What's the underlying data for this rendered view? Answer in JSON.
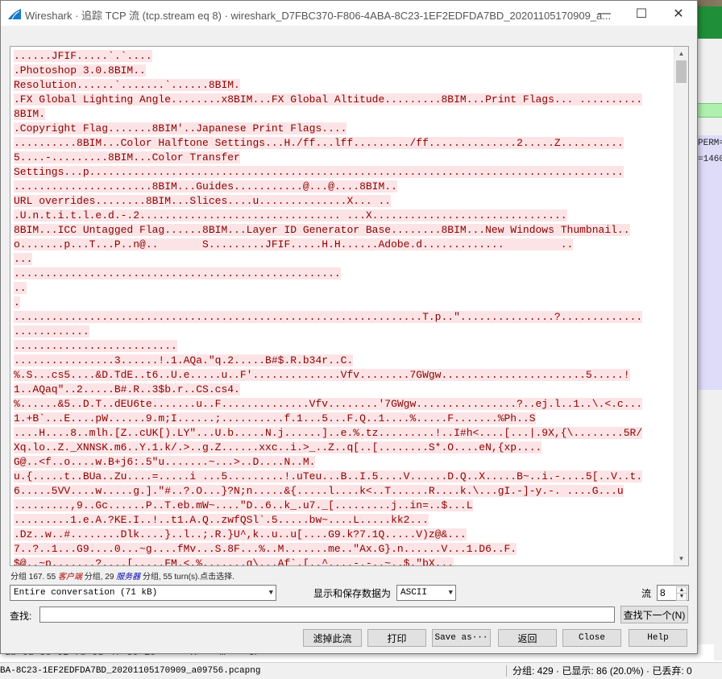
{
  "window": {
    "title": "Wireshark · 追踪 TCP 流 (tcp.stream eq 8) · wireshark_D7FBC370-F806-4ABA-8C23-1EF2EDFDA7BD_20201105170909_a...",
    "minimize_glyph": "—",
    "maximize_glyph": "☐",
    "close_glyph": "✕"
  },
  "stream_lines": [
    "......JFIF.....`.`....",
    ".Photoshop 3.0.8BIM..",
    "Resolution......`.......`......8BIM.",
    ".FX Global Lighting Angle........x8BIM...FX Global Altitude.........8BIM...Print Flags... ..........",
    "8BIM.",
    ".Copyright Flag.......8BIM'..Japanese Print Flags....",
    "..........8BIM...Color Halftone Settings...H./ff...lff........./ff..............2.....Z..........",
    "5....-.........8BIM...Color Transfer",
    "Settings...p.....................................................................................",
    "......................8BIM...Guides...........@...@....8BIM..",
    "URL overrides........8BIM...Slices....u..............X... ..",
    ".U.n.t.i.t.l.e.d.-.2................................ ...X...............................",
    "8BIM...ICC Untagged Flag......8BIM...Layer ID Generator Base........8BIM...New Windows Thumbnail..",
    "o.......p...T...P..n@..       S.........JFIF.....H.H......Adobe.d.............         ..",
    "...",
    "....................................................",
    "..",
    ".",
    ".................................................................T.p..\"...............?.............",
    "............",
    "..........................",
    "................3......!.1.AQa.\"q.2.....B#$.R.b34r..C.",
    "%.S...cs5....&D.TdE..t6..U.e.....u..F'..............Vfv........7GWgw.......................5.....!",
    "1..AQaq\"..2.....B#.R..3$b.r..CS.cs4.",
    "%......&5..D.T..dEU6te.......u..F..............Vfv........'7GWgw................?..ej.l..1..\\.<.c...",
    "1.+B`...E....pW......9.m;I......;..........f.1...5...F.Q..1....%.....F.......%Ph..S",
    "....H....8..mlh.[Z..cUK[).LY\"...U.b.....N.j......]..e.%.tz.........!..I#h<....[...|.9X,{\\........5R/",
    "Xq.lo..Z._XNNSK.m6..Y.1.k/.>..g.Z......xxc..i.>_..Z..q[..[........S*.O....eN,{xp....",
    "G@..<f..o....w.B+j6:.5\"u.......~...>..D....N..M.",
    "u.{.....t..BUa..Zu....=.....i ...5.........!.uTeu...B..I.5....V......D.Q..X.....B~..i.-....5[..V..t.",
    "6.....5VV....w.....g.].\"#..?.O...}?N;n.....&{.....l....k<..T......R....k.\\...gI.-]-y.-. ....G...u",
    ".........,9..Gc......P..T.eb.mW~....\"D..6..k_.u7._[.........j..in=..$...L",
    ".........1.e.A.?KE.I..!..t1.A.Q..zwfQSl`.5.....bw~....L.....kk2...",
    ".Dz..w..#........Dlk....}..l..;.R.}U^,k..u..u[....G9.k?7.1Q.....V)z@&...",
    "7..?..1...G9....0...~g....fMv...S.8F...%..M.......me..\"Ax.G}.n......V...1.D6..F.",
    "$@..~p.......?....[.....FM.<.%.......g\\...Af`.[..^....-.-..~..$.\"bX..."
  ],
  "info": {
    "prefix": "分组 167. 55 ",
    "client_label": "客户端",
    "middle": " 分组, 29 ",
    "server_label": "服务器",
    "suffix": " 分组, 55 turn(s).点击选择."
  },
  "controls": {
    "conversation_select": "Entire conversation (71 kB)",
    "display_label": "显示和保存数据为",
    "format_select": "ASCII",
    "stream_label": "流",
    "stream_value": "8",
    "find_label": "查找:",
    "find_value": "",
    "find_next_button": "查找下一个(N)"
  },
  "buttons": {
    "filter_out": "滤掉此流",
    "print": "打印",
    "save_as": "Save as···",
    "back": "返回",
    "close": "Close",
    "help": "Help"
  },
  "background": {
    "perm_text": "PERM=",
    "perm_num": "=1460",
    "hex_line": "db  0d 5e 02 fb cd 47 30 10   ·+···X··· m ···GP·",
    "status_file": "BA-8C23-1EF2EDFDA7BD_20201105170909_a09756.pcapng",
    "status_stats": "分组: 429 · 已显示: 86 (20.0%) · 已丢弃: 0"
  }
}
